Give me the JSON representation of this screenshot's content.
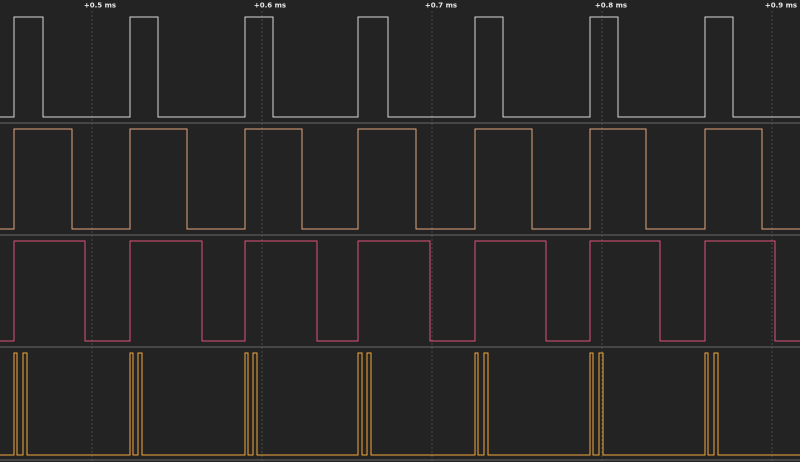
{
  "timebase": {
    "ticks": [
      "+0.5 ms",
      "+0.6 ms",
      "+0.7 ms",
      "+0.8 ms",
      "+0.9 ms"
    ]
  },
  "colors": {
    "background": "#232323",
    "separator": "#6a6a6a",
    "gridline": "#5a5a5a"
  },
  "channels": [
    {
      "color": "#d8d8d8",
      "edges": [
        [
          14,
          43
        ],
        [
          130,
          158
        ],
        [
          245,
          273
        ],
        [
          358,
          388
        ],
        [
          475,
          503
        ],
        [
          590,
          618
        ],
        [
          705,
          733
        ]
      ]
    },
    {
      "color": "#e0a57e",
      "edges": [
        [
          14,
          72
        ],
        [
          130,
          187
        ],
        [
          245,
          302
        ],
        [
          358,
          416
        ],
        [
          475,
          532
        ],
        [
          590,
          646
        ],
        [
          705,
          762
        ]
      ]
    },
    {
      "color": "#e0517a",
      "edges": [
        [
          14,
          85
        ],
        [
          130,
          202
        ],
        [
          245,
          317
        ],
        [
          358,
          430
        ],
        [
          475,
          546
        ],
        [
          590,
          660
        ],
        [
          705,
          775
        ]
      ]
    },
    {
      "color": "#f4a838",
      "edges": [
        [
          14,
          17
        ],
        [
          23,
          27
        ],
        [
          130,
          133
        ],
        [
          138,
          142
        ],
        [
          245,
          248
        ],
        [
          253,
          257
        ],
        [
          358,
          362
        ],
        [
          367,
          371
        ],
        [
          475,
          478
        ],
        [
          484,
          488
        ],
        [
          590,
          593
        ],
        [
          599,
          603
        ],
        [
          705,
          708
        ],
        [
          714,
          718
        ]
      ]
    }
  ]
}
